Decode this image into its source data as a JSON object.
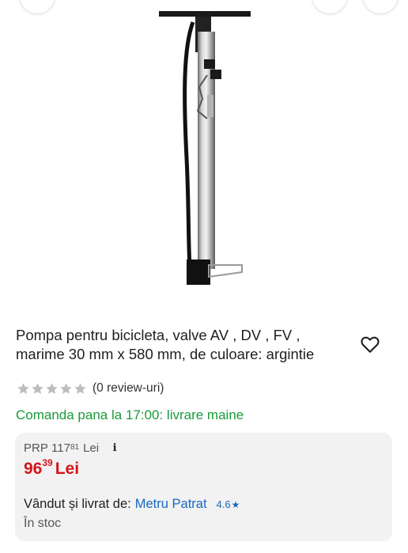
{
  "product": {
    "title": "Pompa pentru bicicleta, valve AV , DV , FV , marime 30 mm x 580 mm, de culoare: argintie",
    "rating_text": "(0 review-uri)",
    "stars_filled": 0,
    "stars_total": 5,
    "delivery_text": "Comanda pana la 17:00: livrare maine"
  },
  "pricing": {
    "prp_label": "PRP",
    "prp_int": "117",
    "prp_dec": "81",
    "prp_currency": "Lei",
    "price_int": "96",
    "price_dec": "39",
    "price_currency": "Lei",
    "info_icon": "info-icon"
  },
  "seller": {
    "label": "Vândut și livrat de:",
    "name": "Metru Patrat",
    "rating": "4.6",
    "stock": "În stoc"
  },
  "icons": {
    "favorite": "heart-icon",
    "star": "star-icon"
  },
  "colors": {
    "price": "#d4151c",
    "delivery": "#1a9a3a",
    "link": "#1768c4",
    "card": "#f2f2f2"
  }
}
